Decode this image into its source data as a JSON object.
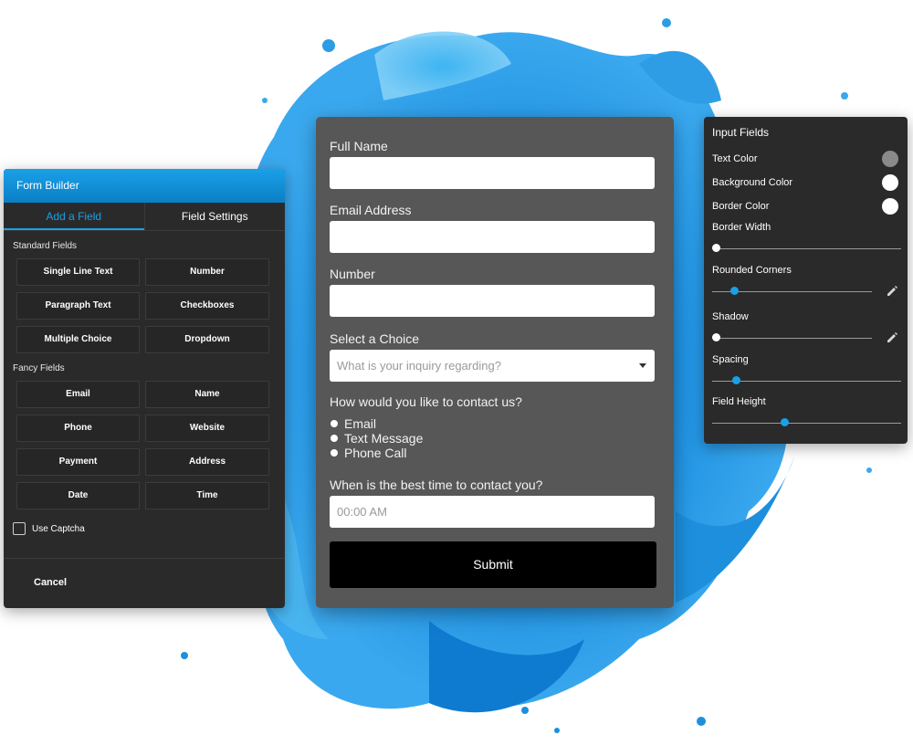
{
  "colors": {
    "accent": "#1aa0e8",
    "form_bg": "#575757",
    "panel_bg": "#2a2a2a",
    "submit_bg": "#000000"
  },
  "form_builder": {
    "title": "Form Builder",
    "tabs": [
      {
        "label": "Add a Field",
        "active": true
      },
      {
        "label": "Field Settings",
        "active": false
      }
    ],
    "standard_fields_heading": "Standard Fields",
    "standard_fields": [
      "Single Line Text",
      "Number",
      "Paragraph Text",
      "Checkboxes",
      "Multiple Choice",
      "Dropdown"
    ],
    "fancy_fields_heading": "Fancy Fields",
    "fancy_fields": [
      "Email",
      "Name",
      "Phone",
      "Website",
      "Payment",
      "Address",
      "Date",
      "Time"
    ],
    "captcha_label": "Use Captcha",
    "captcha_checked": false,
    "cancel_label": "Cancel"
  },
  "form": {
    "full_name_label": "Full Name",
    "email_label": "Email Address",
    "number_label": "Number",
    "select_label": "Select a Choice",
    "select_placeholder": "What is your inquiry regarding?",
    "contact_question": "How would you like to contact us?",
    "contact_options": [
      "Email",
      "Text Message",
      "Phone Call"
    ],
    "time_question": "When is the best time to contact you?",
    "time_placeholder": "00:00 AM",
    "submit_label": "Submit"
  },
  "input_fields": {
    "title": "Input Fields",
    "text_color_label": "Text Color",
    "text_color": "#8a8a8a",
    "background_color_label": "Background Color",
    "background_color": "#ffffff",
    "border_color_label": "Border Color",
    "border_color": "#ffffff",
    "border_width_label": "Border Width",
    "border_width_value": 0.0,
    "rounded_corners_label": "Rounded Corners",
    "rounded_corners_value": 0.12,
    "shadow_label": "Shadow",
    "shadow_value": 0.0,
    "spacing_label": "Spacing",
    "spacing_value": 0.11,
    "field_height_label": "Field Height",
    "field_height_value": 0.38
  }
}
